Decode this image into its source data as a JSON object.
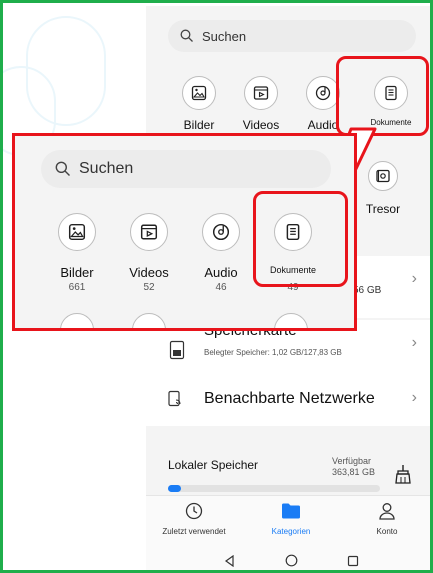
{
  "search": {
    "placeholder": "Suchen"
  },
  "categories": [
    {
      "label": "Bilder",
      "count": "661"
    },
    {
      "label": "Videos",
      "count": "52"
    },
    {
      "label": "Audio",
      "count": "46"
    },
    {
      "label": "Dokumente",
      "count": "49"
    }
  ],
  "categories_second_row": [
    {
      "label": "Tresor"
    }
  ],
  "storage_rows": [
    {
      "title": "",
      "subtitle": "",
      "value": "56 GB"
    },
    {
      "title": "Speicherkarte",
      "subtitle": "Belegter Speicher: 1,02 GB/127,83 GB"
    }
  ],
  "nearby": {
    "label": "Benachbarte Netzwerke"
  },
  "local_storage": {
    "label": "Lokaler Speicher",
    "available_label": "Verfügbar",
    "available_value": "363,81 GB",
    "fill_fraction": 0.06
  },
  "bottom_nav": {
    "recent": "Zuletzt verwendet",
    "categories": "Kategorien",
    "account": "Konto"
  },
  "colors": {
    "accent": "#1a7cf5",
    "highlight": "#e8141b",
    "frame": "#1fae4b"
  }
}
